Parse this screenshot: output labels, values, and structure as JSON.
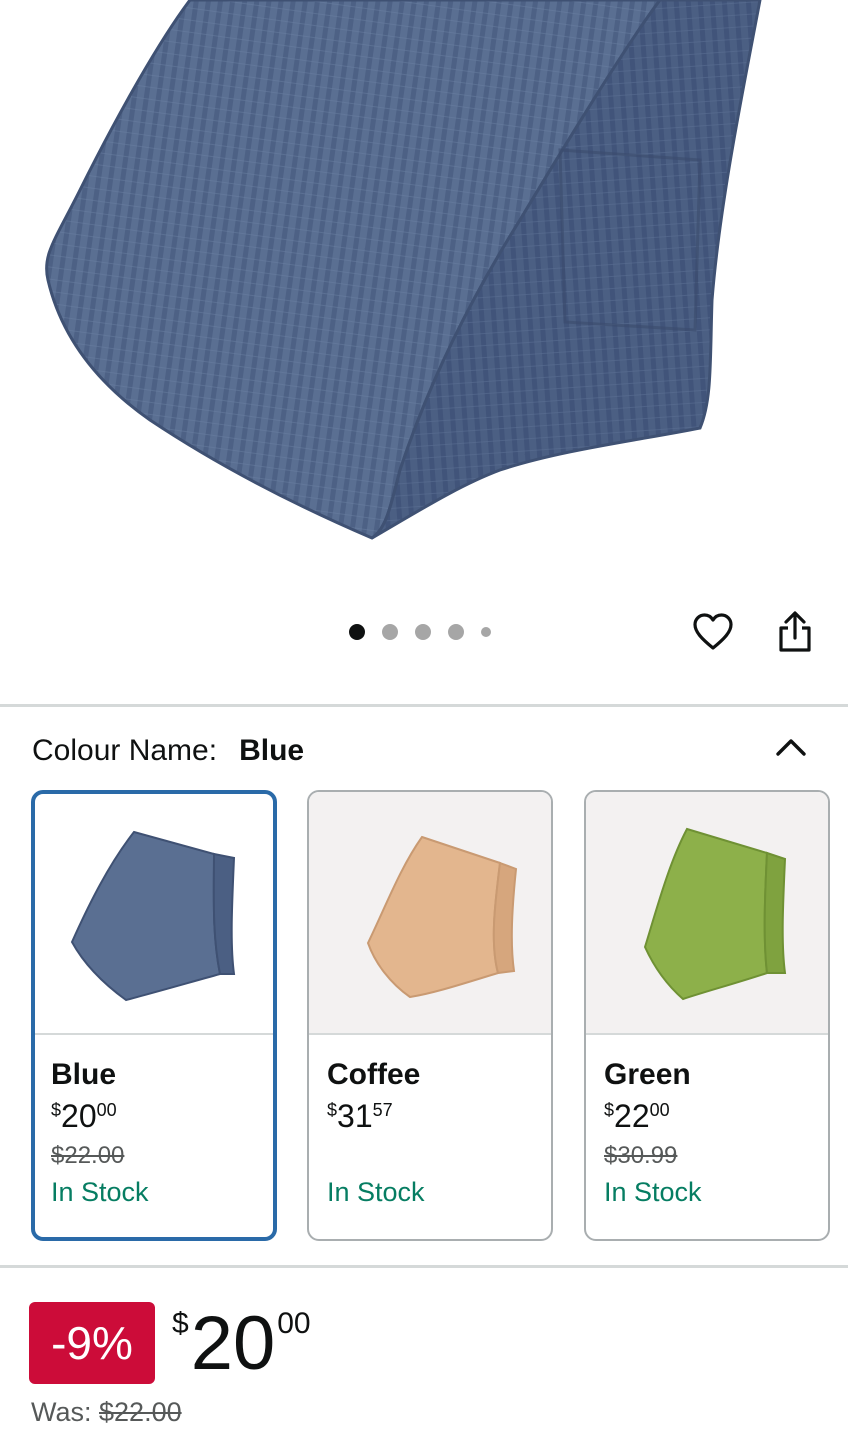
{
  "carousel": {
    "dots": [
      "active",
      "",
      "",
      "",
      "small"
    ]
  },
  "colour": {
    "label": "Colour Name:",
    "selected": "Blue"
  },
  "swatches": [
    {
      "name": "Blue",
      "currency": "$",
      "whole": "20",
      "fraction": "00",
      "was": "$22.00",
      "stock": "In Stock",
      "color": "#5a6f92",
      "selected": true
    },
    {
      "name": "Coffee",
      "currency": "$",
      "whole": "31",
      "fraction": "57",
      "was": "",
      "stock": "In Stock",
      "color": "#e3b68e",
      "selected": false
    },
    {
      "name": "Green",
      "currency": "$",
      "whole": "22",
      "fraction": "00",
      "was": "$30.99",
      "stock": "In Stock",
      "color": "#8db04a",
      "selected": false
    }
  ],
  "price": {
    "discount": "-9%",
    "currency": "$",
    "whole": "20",
    "fraction": "00",
    "was_label": "Was: ",
    "was_value": "$22.00"
  },
  "colors": {
    "accent_selected": "#2a6aa8",
    "deal_red": "#cc0c39",
    "stock_green": "#067d62"
  }
}
